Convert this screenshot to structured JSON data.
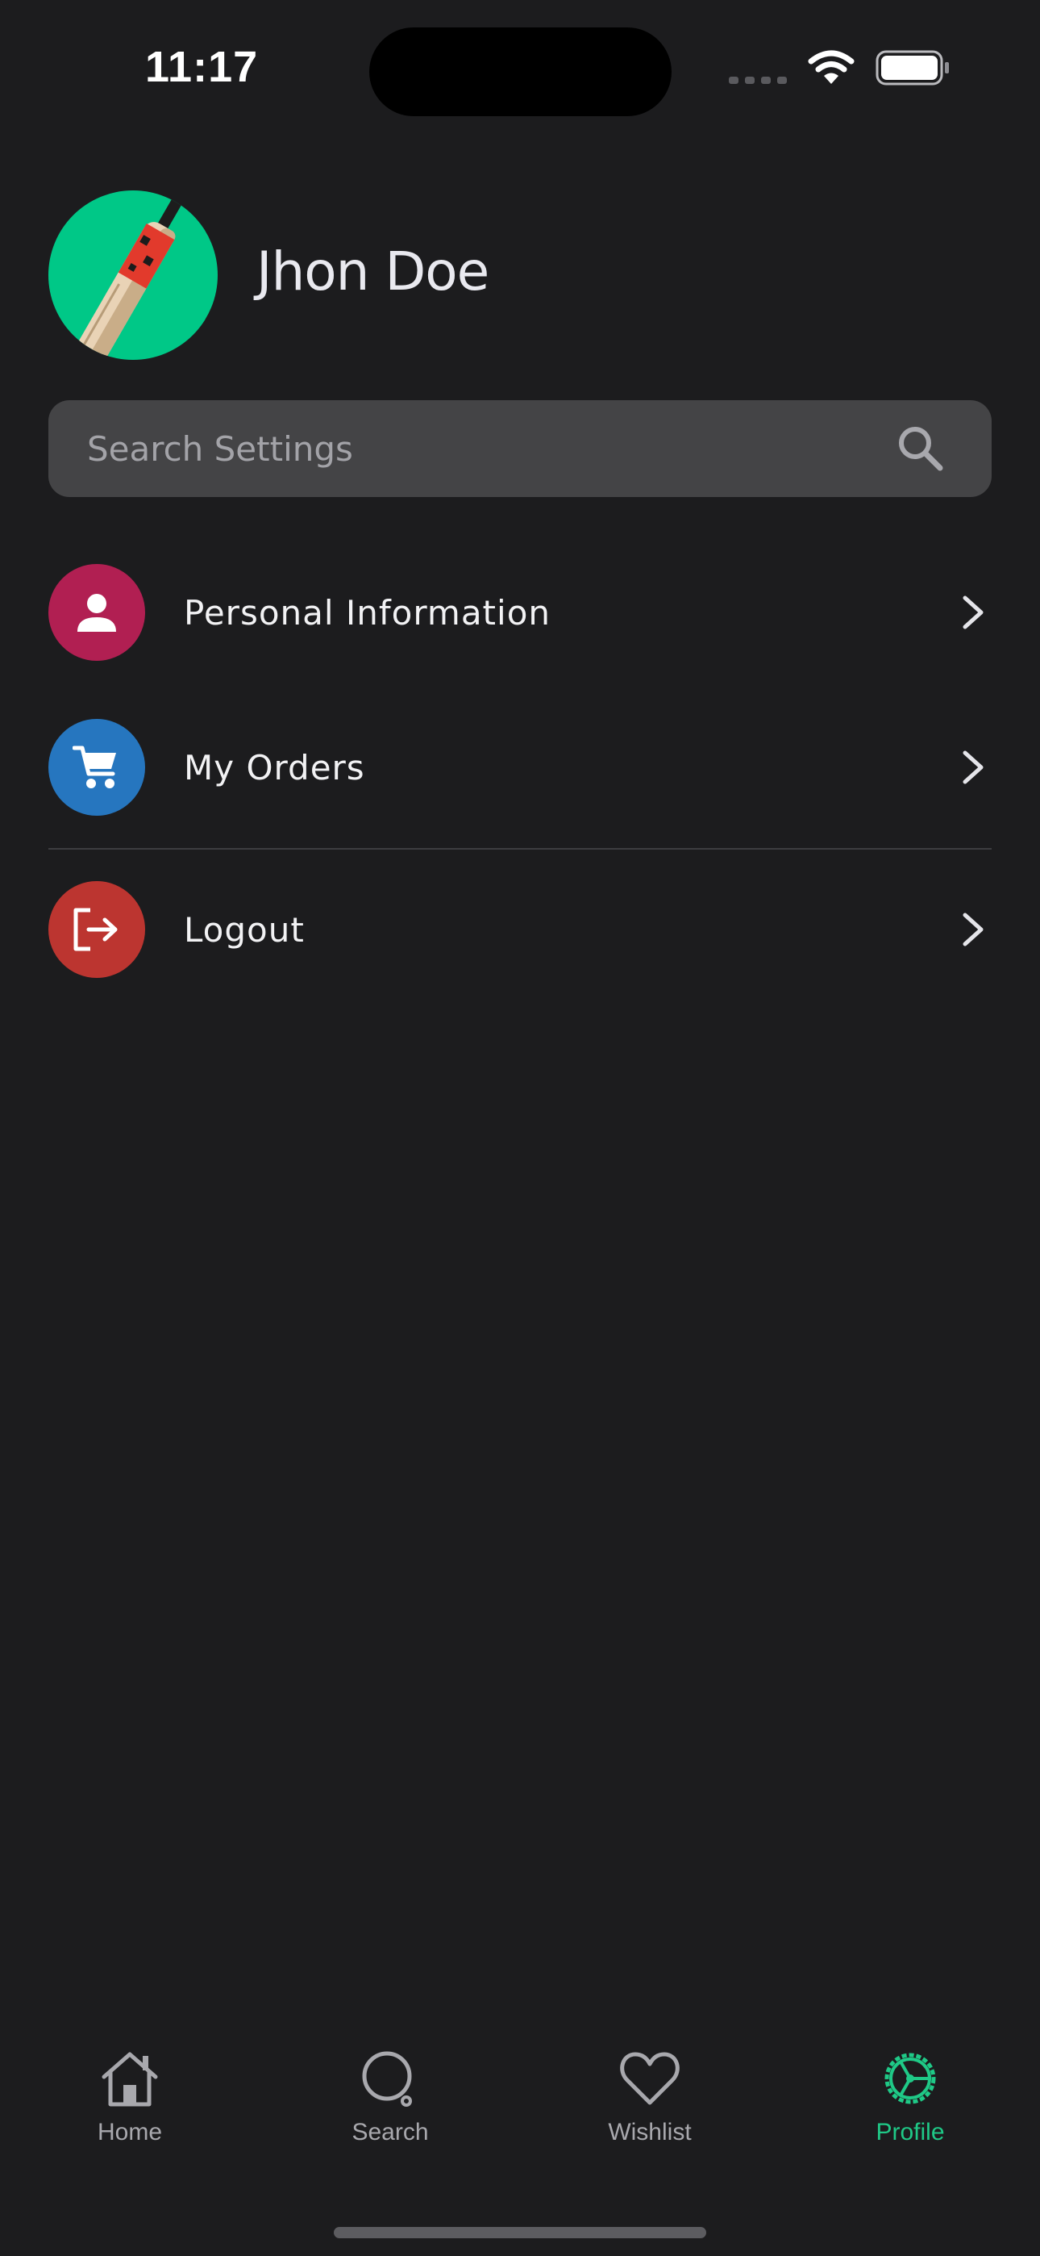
{
  "status_bar": {
    "time": "11:17"
  },
  "profile": {
    "name": "Jhon Doe",
    "avatar_icon": "cricket-bat-icon"
  },
  "search": {
    "placeholder": "Search Settings",
    "icon": "search-icon"
  },
  "menu": {
    "items": [
      {
        "label": "Personal Information",
        "icon": "person-icon",
        "color": "#b11f52"
      },
      {
        "label": "My Orders",
        "icon": "cart-icon",
        "color": "#2676bf"
      },
      {
        "label": "Logout",
        "icon": "logout-icon",
        "color": "#bc3530"
      }
    ]
  },
  "tab_bar": {
    "active_color": "#1fc987",
    "tabs": [
      {
        "label": "Home",
        "icon": "home-icon",
        "active": false
      },
      {
        "label": "Search",
        "icon": "search-icon",
        "active": false
      },
      {
        "label": "Wishlist",
        "icon": "heart-icon",
        "active": false
      },
      {
        "label": "Profile",
        "icon": "gear-icon",
        "active": true
      }
    ]
  }
}
